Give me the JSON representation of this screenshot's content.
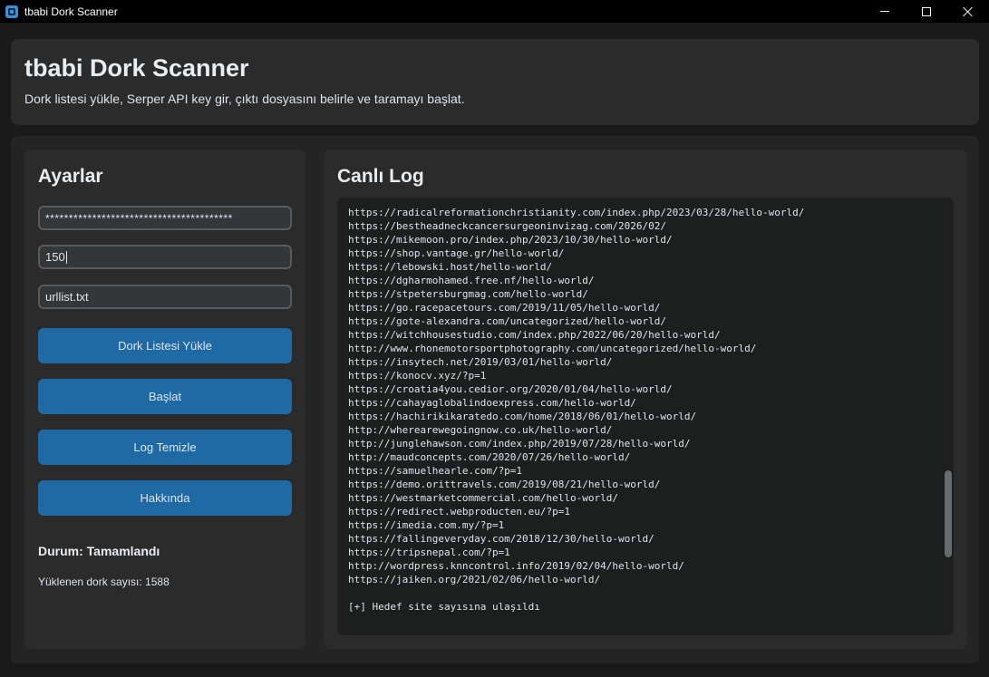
{
  "window": {
    "title": "tbabi Dork Scanner",
    "app_icon": "app-logo-icon",
    "controls": [
      "minimize-icon",
      "maximize-icon",
      "close-icon"
    ]
  },
  "header": {
    "title": "tbabi Dork Scanner",
    "subtitle": "Dork listesi yükle, Serper API key gir, çıktı dosyasını belirle ve taramayı başlat."
  },
  "settings": {
    "title": "Ayarlar",
    "api_key_value": "****************************************",
    "count_value": "150",
    "output_file_value": "urllist.txt",
    "buttons": {
      "load": "Dork Listesi Yükle",
      "start": "Başlat",
      "clear": "Log Temizle",
      "about": "Hakkında"
    },
    "status": "Durum: Tamamlandı",
    "loaded_count": "Yüklenen dork sayısı: 1588"
  },
  "log": {
    "title": "Canlı Log",
    "lines": [
      "https://radicalreformationchristianity.com/index.php/2023/03/28/hello-world/",
      "https://bestheadneckcancersurgeoninvizag.com/2026/02/",
      "https://mikemoon.pro/index.php/2023/10/30/hello-world/",
      "https://shop.vantage.gr/hello-world/",
      "https://lebowski.host/hello-world/",
      "https://dgharmohamed.free.nf/hello-world/",
      "https://stpetersburgmag.com/hello-world/",
      "https://go.racepacetours.com/2019/11/05/hello-world/",
      "https://gote-alexandra.com/uncategorized/hello-world/",
      "https://witchhousestudio.com/index.php/2022/06/20/hello-world/",
      "http://www.rhonemotorsportphotography.com/uncategorized/hello-world/",
      "https://insytech.net/2019/03/01/hello-world/",
      "https://konocv.xyz/?p=1",
      "https://croatia4you.cedior.org/2020/01/04/hello-world/",
      "https://cahayaglobalindoexpress.com/hello-world/",
      "https://hachirikikaratedo.com/home/2018/06/01/hello-world/",
      "http://wherearewegoingnow.co.uk/hello-world/",
      "http://junglehawson.com/index.php/2019/07/28/hello-world/",
      "http://maudconcepts.com/2020/07/26/hello-world/",
      "https://samuelhearle.com/?p=1",
      "https://demo.orittravels.com/2019/08/21/hello-world/",
      "https://westmarketcommercial.com/hello-world/",
      "https://redirect.webproducten.eu/?p=1",
      "https://imedia.com.my/?p=1",
      "https://fallingeveryday.com/2018/12/30/hello-world/",
      "https://tripsnepal.com/?p=1",
      "http://wordpress.knncontrol.info/2019/02/04/hello-world/",
      "https://jaiken.org/2021/02/06/hello-world/",
      "",
      "[+] Hedef site sayısına ulaşıldı"
    ],
    "scroll_position": 0.79
  },
  "colors": {
    "accent": "#1f6aa5",
    "panel": "#2b2b2b",
    "background": "#1a1a1a"
  }
}
